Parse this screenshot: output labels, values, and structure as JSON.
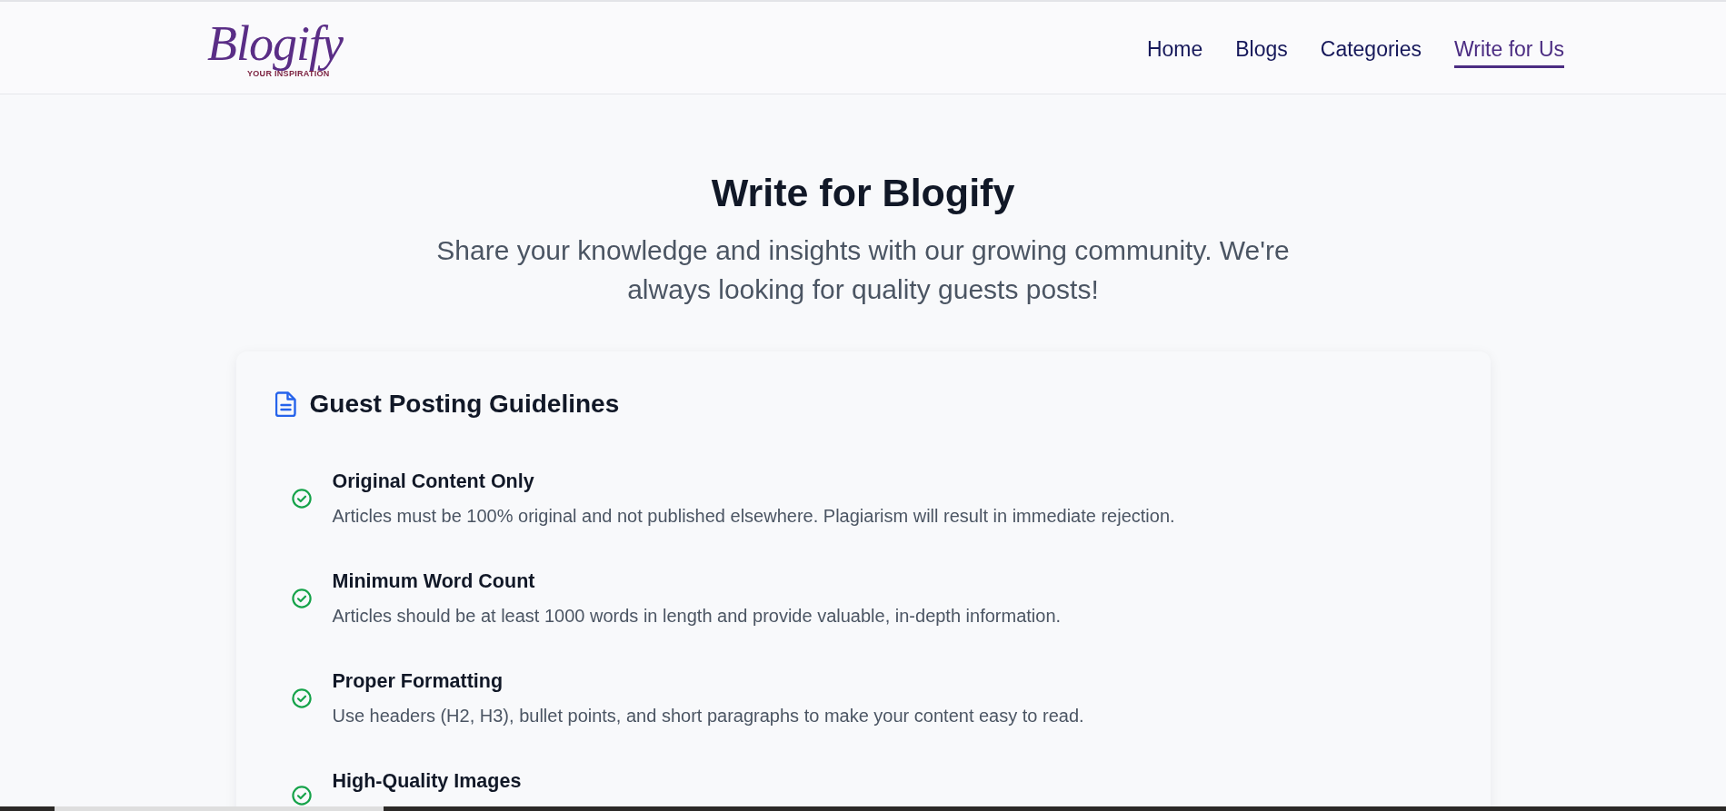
{
  "header": {
    "logo": {
      "wordmark": "Blogify",
      "tagline": "YOUR INSPIRATION"
    },
    "nav": [
      {
        "label": "Home",
        "selected": false
      },
      {
        "label": "Blogs",
        "selected": false
      },
      {
        "label": "Categories",
        "selected": false
      },
      {
        "label": "Write for Us",
        "selected": true
      }
    ]
  },
  "hero": {
    "title": "Write for Blogify",
    "subtitle": "Share your knowledge and insights with our growing community. We're always looking for quality guests posts!"
  },
  "guidelines": {
    "title": "Guest Posting Guidelines",
    "items": [
      {
        "title": "Original Content Only",
        "description": "Articles must be 100% original and not published elsewhere. Plagiarism will result in immediate rejection."
      },
      {
        "title": "Minimum Word Count",
        "description": "Articles should be at least 1000 words in length and provide valuable, in-depth information."
      },
      {
        "title": "Proper Formatting",
        "description": "Use headers (H2, H3), bullet points, and short paragraphs to make your content easy to read."
      },
      {
        "title": "High-Quality Images"
      }
    ]
  }
}
